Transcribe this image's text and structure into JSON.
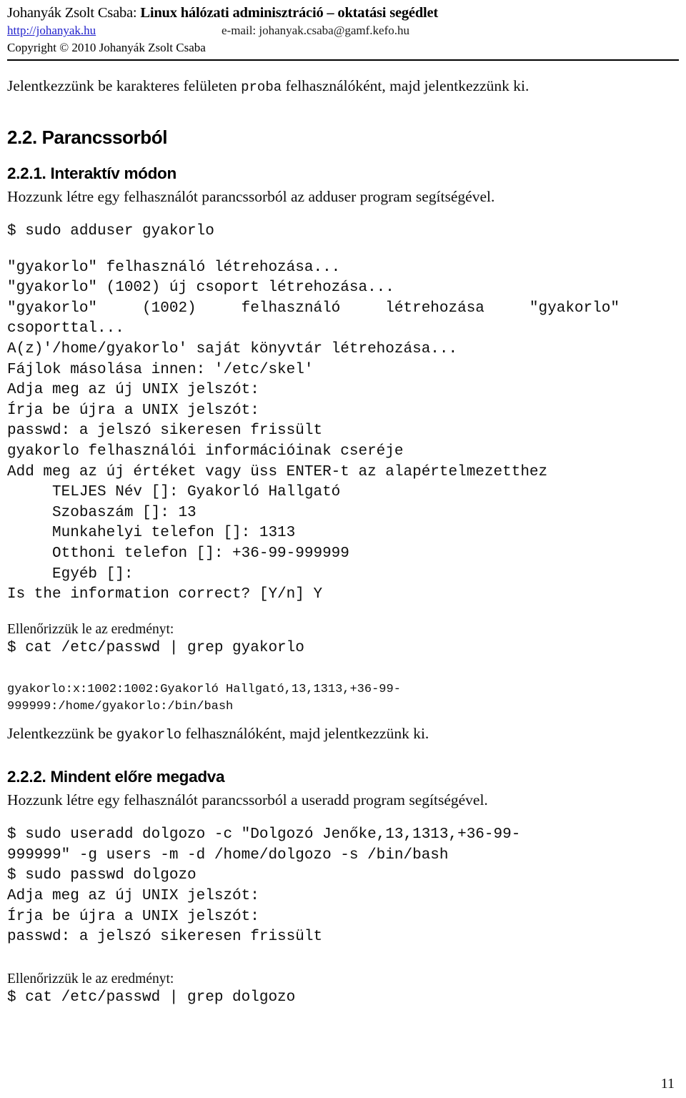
{
  "header": {
    "author_prefix": "Johanyák Zsolt Csaba: ",
    "title": "Linux hálózati adminisztráció – oktatási segédlet",
    "url": "http://johanyak.hu",
    "email": "e-mail: johanyak.csaba@gamf.kefo.hu",
    "copyright": "Copyright © 2010 Johanyák Zsolt Csaba",
    "link_color": "#2222cc"
  },
  "intro": {
    "part1": "Jelentkezzünk be karakteres felületen ",
    "mono": "proba",
    "part2": " felhasználóként, majd jelentkezzünk ki."
  },
  "section_22": {
    "heading": "2.2. Parancssorból"
  },
  "section_221": {
    "heading": "2.2.1. Interaktív módon",
    "intro": "Hozzunk létre egy felhasználót parancssorból az adduser program segítségével.",
    "command": "$ sudo adduser gyakorlo",
    "output_lines_a": [
      "\"gyakorlo\" felhasználó létrehozása...",
      "\"gyakorlo\" (1002) új csoport létrehozása..."
    ],
    "justified_line": "\"gyakorlo\"     (1002)     felhasználó     létrehozása     \"gyakorlo\"",
    "output_lines_b": [
      "csoporttal...",
      "A(z)'/home/gyakorlo' saját könyvtár létrehozása...",
      "Fájlok másolása innen: '/etc/skel'",
      "Adja meg az új UNIX jelszót:",
      "Írja be újra a UNIX jelszót:",
      "passwd: a jelszó sikeresen frissült",
      "gyakorlo felhasználói információinak cseréje",
      "Add meg az új értéket vagy üss ENTER-t az alapértelmezetthez",
      "     TELJES Név []: Gyakorló Hallgató",
      "     Szobaszám []: 13",
      "     Munkahelyi telefon []: 1313",
      "     Otthoni telefon []: +36-99-999999",
      "     Egyéb []:",
      "Is the information correct? [Y/n] Y"
    ],
    "check_label": "Ellenőrizzük le az eredményt:",
    "check_command": "$ cat /etc/passwd | grep gyakorlo",
    "passwd_output": [
      "gyakorlo:x:1002:1002:Gyakorló Hallgató,13,1313,+36-99-",
      "999999:/home/gyakorlo:/bin/bash"
    ],
    "closing": {
      "part1": "Jelentkezzünk be ",
      "mono": "gyakorlo",
      "part2": " felhasználóként, majd jelentkezzünk ki."
    }
  },
  "section_222": {
    "heading": "2.2.2. Mindent előre megadva",
    "intro": "Hozzunk létre egy felhasználót parancssorból a useradd program segítségével.",
    "commands": [
      "$ sudo useradd dolgozo -c \"Dolgozó Jenőke,13,1313,+36-99-",
      "999999\" -g users -m -d /home/dolgozo -s /bin/bash",
      "$ sudo passwd dolgozo",
      "Adja meg az új UNIX jelszót:",
      "Írja be újra a UNIX jelszót:",
      "passwd: a jelszó sikeresen frissült"
    ],
    "check_label": "Ellenőrizzük le az eredményt:",
    "check_command": "$ cat /etc/passwd | grep dolgozo"
  },
  "footer": {
    "page_number": "11"
  }
}
